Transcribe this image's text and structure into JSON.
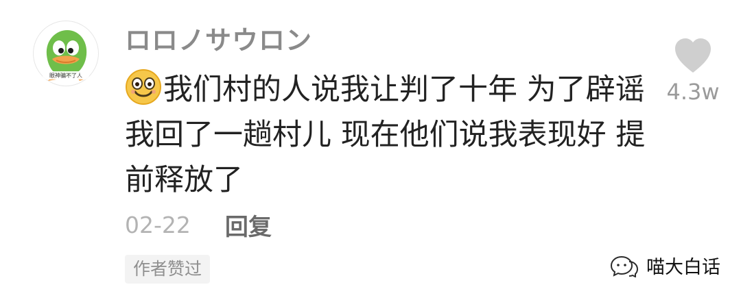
{
  "comment": {
    "username": "ロロノサウロン",
    "emoji_icon": "smiling-face-emoji",
    "text": "我们村的人说我让判了十年 为了辟谣我回了一趟村儿 现在他们说我表现好 提前释放了",
    "date": "02-22",
    "reply_label": "回复",
    "author_liked_tag": "作者赞过",
    "avatar_icon": "cartoon-duck-avatar",
    "avatar_caption": "眼神骗不了人"
  },
  "like": {
    "icon": "heart-icon",
    "count": "4.3w"
  },
  "watermark": {
    "icon": "wechat-icon",
    "text": "喵大白话"
  },
  "colors": {
    "username": "#8a8a8a",
    "text": "#222222",
    "muted": "#b3b3b3",
    "heart": "#cfcfcf",
    "tag_bg": "#f3f3f3"
  }
}
